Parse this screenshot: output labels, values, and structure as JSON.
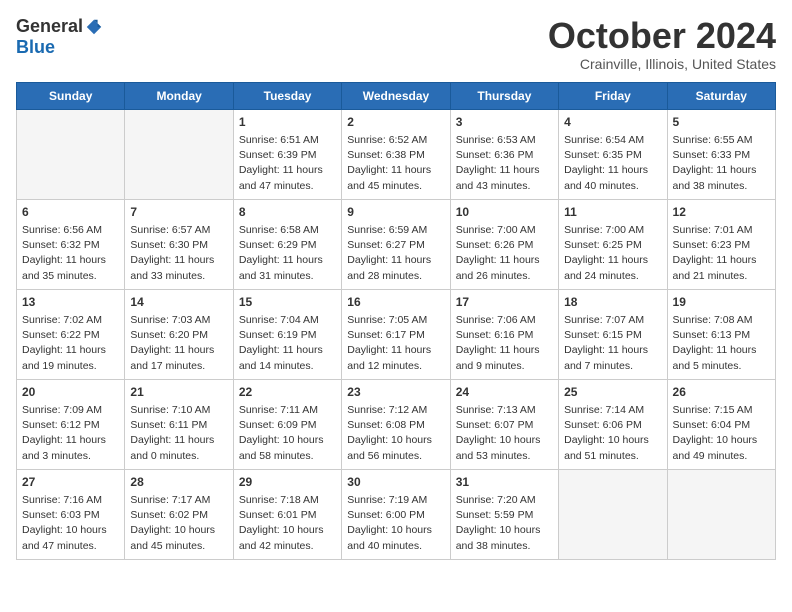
{
  "header": {
    "logo_general": "General",
    "logo_blue": "Blue",
    "month": "October 2024",
    "location": "Crainville, Illinois, United States"
  },
  "days_of_week": [
    "Sunday",
    "Monday",
    "Tuesday",
    "Wednesday",
    "Thursday",
    "Friday",
    "Saturday"
  ],
  "weeks": [
    [
      {
        "day": null
      },
      {
        "day": null
      },
      {
        "day": "1",
        "sunrise": "Sunrise: 6:51 AM",
        "sunset": "Sunset: 6:39 PM",
        "daylight": "Daylight: 11 hours and 47 minutes."
      },
      {
        "day": "2",
        "sunrise": "Sunrise: 6:52 AM",
        "sunset": "Sunset: 6:38 PM",
        "daylight": "Daylight: 11 hours and 45 minutes."
      },
      {
        "day": "3",
        "sunrise": "Sunrise: 6:53 AM",
        "sunset": "Sunset: 6:36 PM",
        "daylight": "Daylight: 11 hours and 43 minutes."
      },
      {
        "day": "4",
        "sunrise": "Sunrise: 6:54 AM",
        "sunset": "Sunset: 6:35 PM",
        "daylight": "Daylight: 11 hours and 40 minutes."
      },
      {
        "day": "5",
        "sunrise": "Sunrise: 6:55 AM",
        "sunset": "Sunset: 6:33 PM",
        "daylight": "Daylight: 11 hours and 38 minutes."
      }
    ],
    [
      {
        "day": "6",
        "sunrise": "Sunrise: 6:56 AM",
        "sunset": "Sunset: 6:32 PM",
        "daylight": "Daylight: 11 hours and 35 minutes."
      },
      {
        "day": "7",
        "sunrise": "Sunrise: 6:57 AM",
        "sunset": "Sunset: 6:30 PM",
        "daylight": "Daylight: 11 hours and 33 minutes."
      },
      {
        "day": "8",
        "sunrise": "Sunrise: 6:58 AM",
        "sunset": "Sunset: 6:29 PM",
        "daylight": "Daylight: 11 hours and 31 minutes."
      },
      {
        "day": "9",
        "sunrise": "Sunrise: 6:59 AM",
        "sunset": "Sunset: 6:27 PM",
        "daylight": "Daylight: 11 hours and 28 minutes."
      },
      {
        "day": "10",
        "sunrise": "Sunrise: 7:00 AM",
        "sunset": "Sunset: 6:26 PM",
        "daylight": "Daylight: 11 hours and 26 minutes."
      },
      {
        "day": "11",
        "sunrise": "Sunrise: 7:00 AM",
        "sunset": "Sunset: 6:25 PM",
        "daylight": "Daylight: 11 hours and 24 minutes."
      },
      {
        "day": "12",
        "sunrise": "Sunrise: 7:01 AM",
        "sunset": "Sunset: 6:23 PM",
        "daylight": "Daylight: 11 hours and 21 minutes."
      }
    ],
    [
      {
        "day": "13",
        "sunrise": "Sunrise: 7:02 AM",
        "sunset": "Sunset: 6:22 PM",
        "daylight": "Daylight: 11 hours and 19 minutes."
      },
      {
        "day": "14",
        "sunrise": "Sunrise: 7:03 AM",
        "sunset": "Sunset: 6:20 PM",
        "daylight": "Daylight: 11 hours and 17 minutes."
      },
      {
        "day": "15",
        "sunrise": "Sunrise: 7:04 AM",
        "sunset": "Sunset: 6:19 PM",
        "daylight": "Daylight: 11 hours and 14 minutes."
      },
      {
        "day": "16",
        "sunrise": "Sunrise: 7:05 AM",
        "sunset": "Sunset: 6:17 PM",
        "daylight": "Daylight: 11 hours and 12 minutes."
      },
      {
        "day": "17",
        "sunrise": "Sunrise: 7:06 AM",
        "sunset": "Sunset: 6:16 PM",
        "daylight": "Daylight: 11 hours and 9 minutes."
      },
      {
        "day": "18",
        "sunrise": "Sunrise: 7:07 AM",
        "sunset": "Sunset: 6:15 PM",
        "daylight": "Daylight: 11 hours and 7 minutes."
      },
      {
        "day": "19",
        "sunrise": "Sunrise: 7:08 AM",
        "sunset": "Sunset: 6:13 PM",
        "daylight": "Daylight: 11 hours and 5 minutes."
      }
    ],
    [
      {
        "day": "20",
        "sunrise": "Sunrise: 7:09 AM",
        "sunset": "Sunset: 6:12 PM",
        "daylight": "Daylight: 11 hours and 3 minutes."
      },
      {
        "day": "21",
        "sunrise": "Sunrise: 7:10 AM",
        "sunset": "Sunset: 6:11 PM",
        "daylight": "Daylight: 11 hours and 0 minutes."
      },
      {
        "day": "22",
        "sunrise": "Sunrise: 7:11 AM",
        "sunset": "Sunset: 6:09 PM",
        "daylight": "Daylight: 10 hours and 58 minutes."
      },
      {
        "day": "23",
        "sunrise": "Sunrise: 7:12 AM",
        "sunset": "Sunset: 6:08 PM",
        "daylight": "Daylight: 10 hours and 56 minutes."
      },
      {
        "day": "24",
        "sunrise": "Sunrise: 7:13 AM",
        "sunset": "Sunset: 6:07 PM",
        "daylight": "Daylight: 10 hours and 53 minutes."
      },
      {
        "day": "25",
        "sunrise": "Sunrise: 7:14 AM",
        "sunset": "Sunset: 6:06 PM",
        "daylight": "Daylight: 10 hours and 51 minutes."
      },
      {
        "day": "26",
        "sunrise": "Sunrise: 7:15 AM",
        "sunset": "Sunset: 6:04 PM",
        "daylight": "Daylight: 10 hours and 49 minutes."
      }
    ],
    [
      {
        "day": "27",
        "sunrise": "Sunrise: 7:16 AM",
        "sunset": "Sunset: 6:03 PM",
        "daylight": "Daylight: 10 hours and 47 minutes."
      },
      {
        "day": "28",
        "sunrise": "Sunrise: 7:17 AM",
        "sunset": "Sunset: 6:02 PM",
        "daylight": "Daylight: 10 hours and 45 minutes."
      },
      {
        "day": "29",
        "sunrise": "Sunrise: 7:18 AM",
        "sunset": "Sunset: 6:01 PM",
        "daylight": "Daylight: 10 hours and 42 minutes."
      },
      {
        "day": "30",
        "sunrise": "Sunrise: 7:19 AM",
        "sunset": "Sunset: 6:00 PM",
        "daylight": "Daylight: 10 hours and 40 minutes."
      },
      {
        "day": "31",
        "sunrise": "Sunrise: 7:20 AM",
        "sunset": "Sunset: 5:59 PM",
        "daylight": "Daylight: 10 hours and 38 minutes."
      },
      {
        "day": null
      },
      {
        "day": null
      }
    ]
  ]
}
